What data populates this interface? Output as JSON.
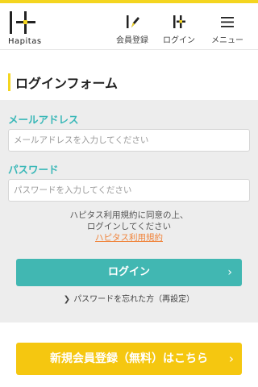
{
  "brand": {
    "name": "Hapitas",
    "accent": "#f4d51f"
  },
  "header": {
    "nav": [
      {
        "label": "会員登録",
        "icon": "pen-icon"
      },
      {
        "label": "ログイン",
        "icon": "login-icon"
      },
      {
        "label": "メニュー",
        "icon": "hamburger-menu-icon"
      }
    ]
  },
  "page": {
    "title": "ログインフォーム"
  },
  "form": {
    "email_label": "メールアドレス",
    "email_placeholder": "メールアドレスを入力してください",
    "email_value": "",
    "password_label": "パスワード",
    "password_placeholder": "パスワードを入力してください",
    "password_value": "",
    "notice_line1": "ハピタス利用規約に同意の上、",
    "notice_line2": "ログインしてください",
    "terms_link": "ハピタス利用規約",
    "login_button": "ログイン",
    "forgot_link": "パスワードを忘れた方（再設定）"
  },
  "register": {
    "button_label": "新規会員登録（無料）はこちら"
  },
  "colors": {
    "teal": "#41b7b2",
    "label_teal": "#3ab8b8",
    "link_orange": "#f0833a",
    "register_yellow": "#f5c710",
    "panel_gray": "#ededed"
  }
}
